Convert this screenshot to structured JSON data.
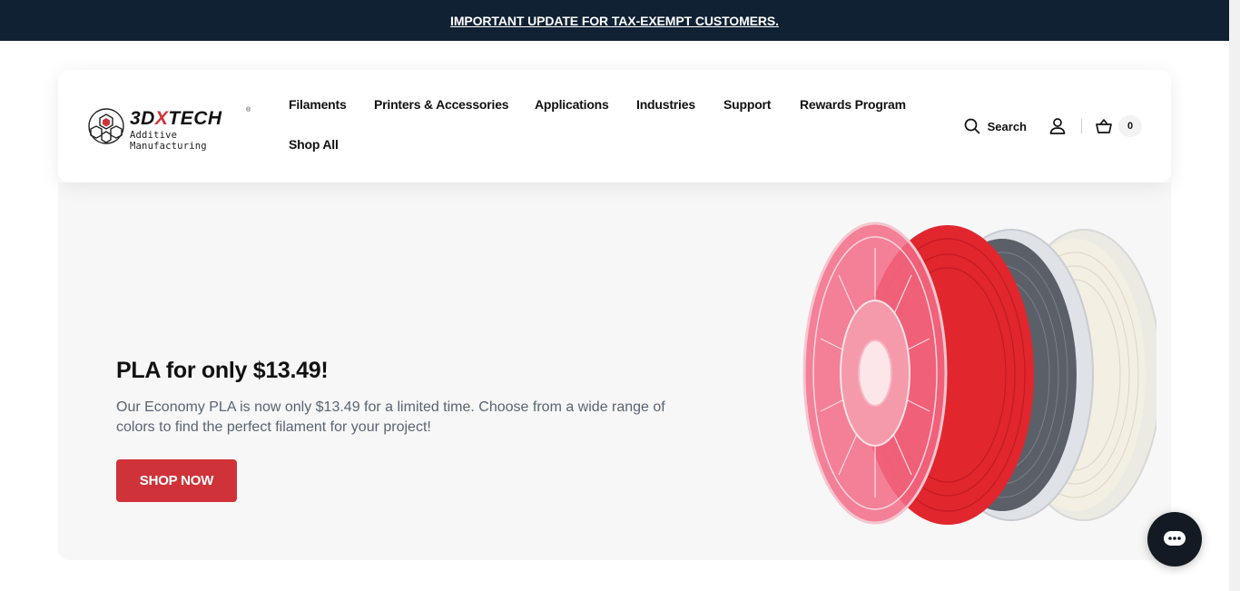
{
  "announcement": {
    "text": "IMPORTANT UPDATE FOR TAX-EXEMPT CUSTOMERS."
  },
  "logo": {
    "wordmark_pre": "3D",
    "wordmark_x": "X",
    "wordmark_post": "TECH",
    "registered": "®",
    "tagline": "Additive Manufacturing"
  },
  "nav": {
    "items": [
      "Filaments",
      "Printers & Accessories",
      "Applications",
      "Industries",
      "Support",
      "Rewards Program",
      "Shop All"
    ]
  },
  "tools": {
    "search_label": "Search",
    "cart_count": "0"
  },
  "hero": {
    "title": "PLA for only $13.49!",
    "description": "Our Economy PLA is now only $13.49 for a limited time. Choose from a wide range of colors to find the perfect filament for your project!",
    "cta_label": "SHOP NOW"
  },
  "colors": {
    "accent": "#cf3339",
    "announcement_bg": "#0f2133",
    "chat_bg": "#141a23"
  },
  "icons": [
    "search-icon",
    "account-icon",
    "cart-icon",
    "chat-icon"
  ]
}
